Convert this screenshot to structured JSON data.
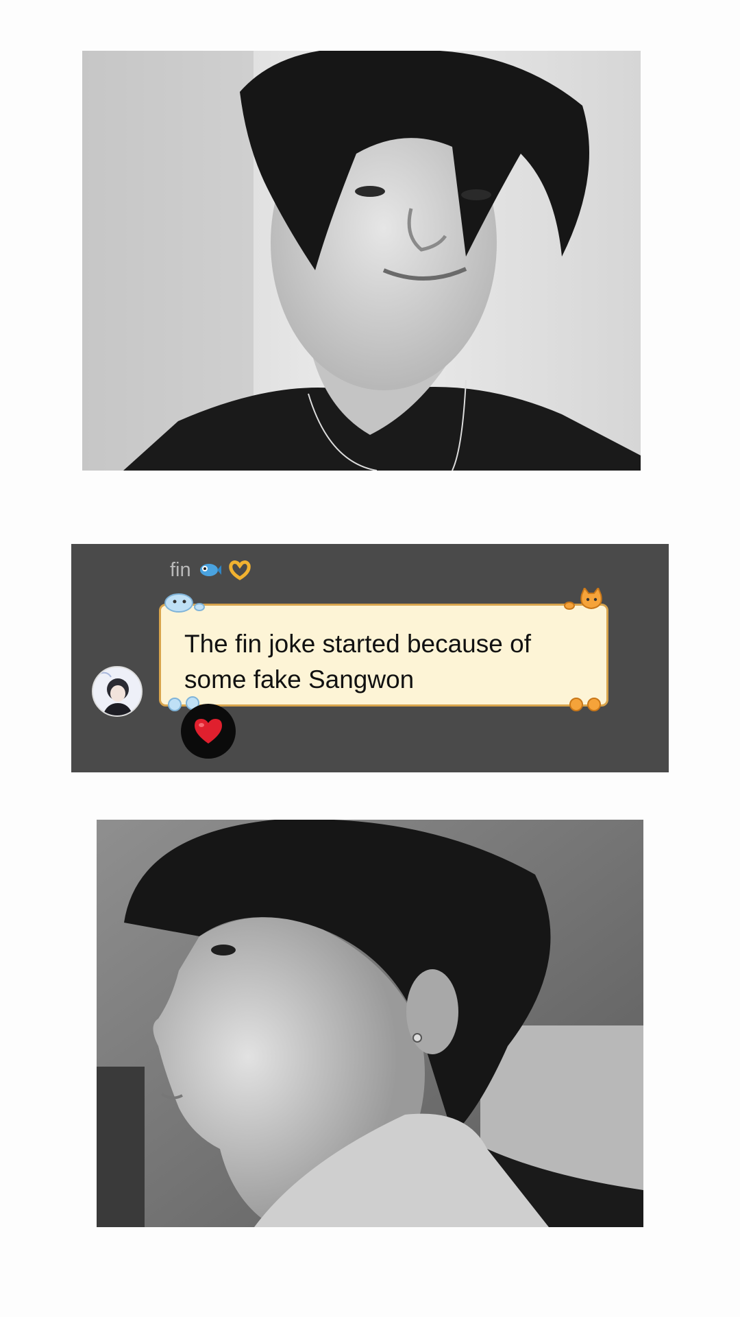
{
  "images": {
    "top_photo": "black-and-white portrait photo",
    "bottom_photo": "black-and-white side profile photo"
  },
  "message": {
    "sender_name": "fin",
    "sender_emojis": [
      "fish-emoji",
      "heart-hands-emoji"
    ],
    "text": "The fin joke started because of some fake Sangwon",
    "reaction": "red-heart-emoji"
  },
  "colors": {
    "card_background": "#4a4a4a",
    "bubble_background": "#fdf4d6",
    "bubble_border": "#d8a44c",
    "reaction_heart": "#e0202e"
  }
}
